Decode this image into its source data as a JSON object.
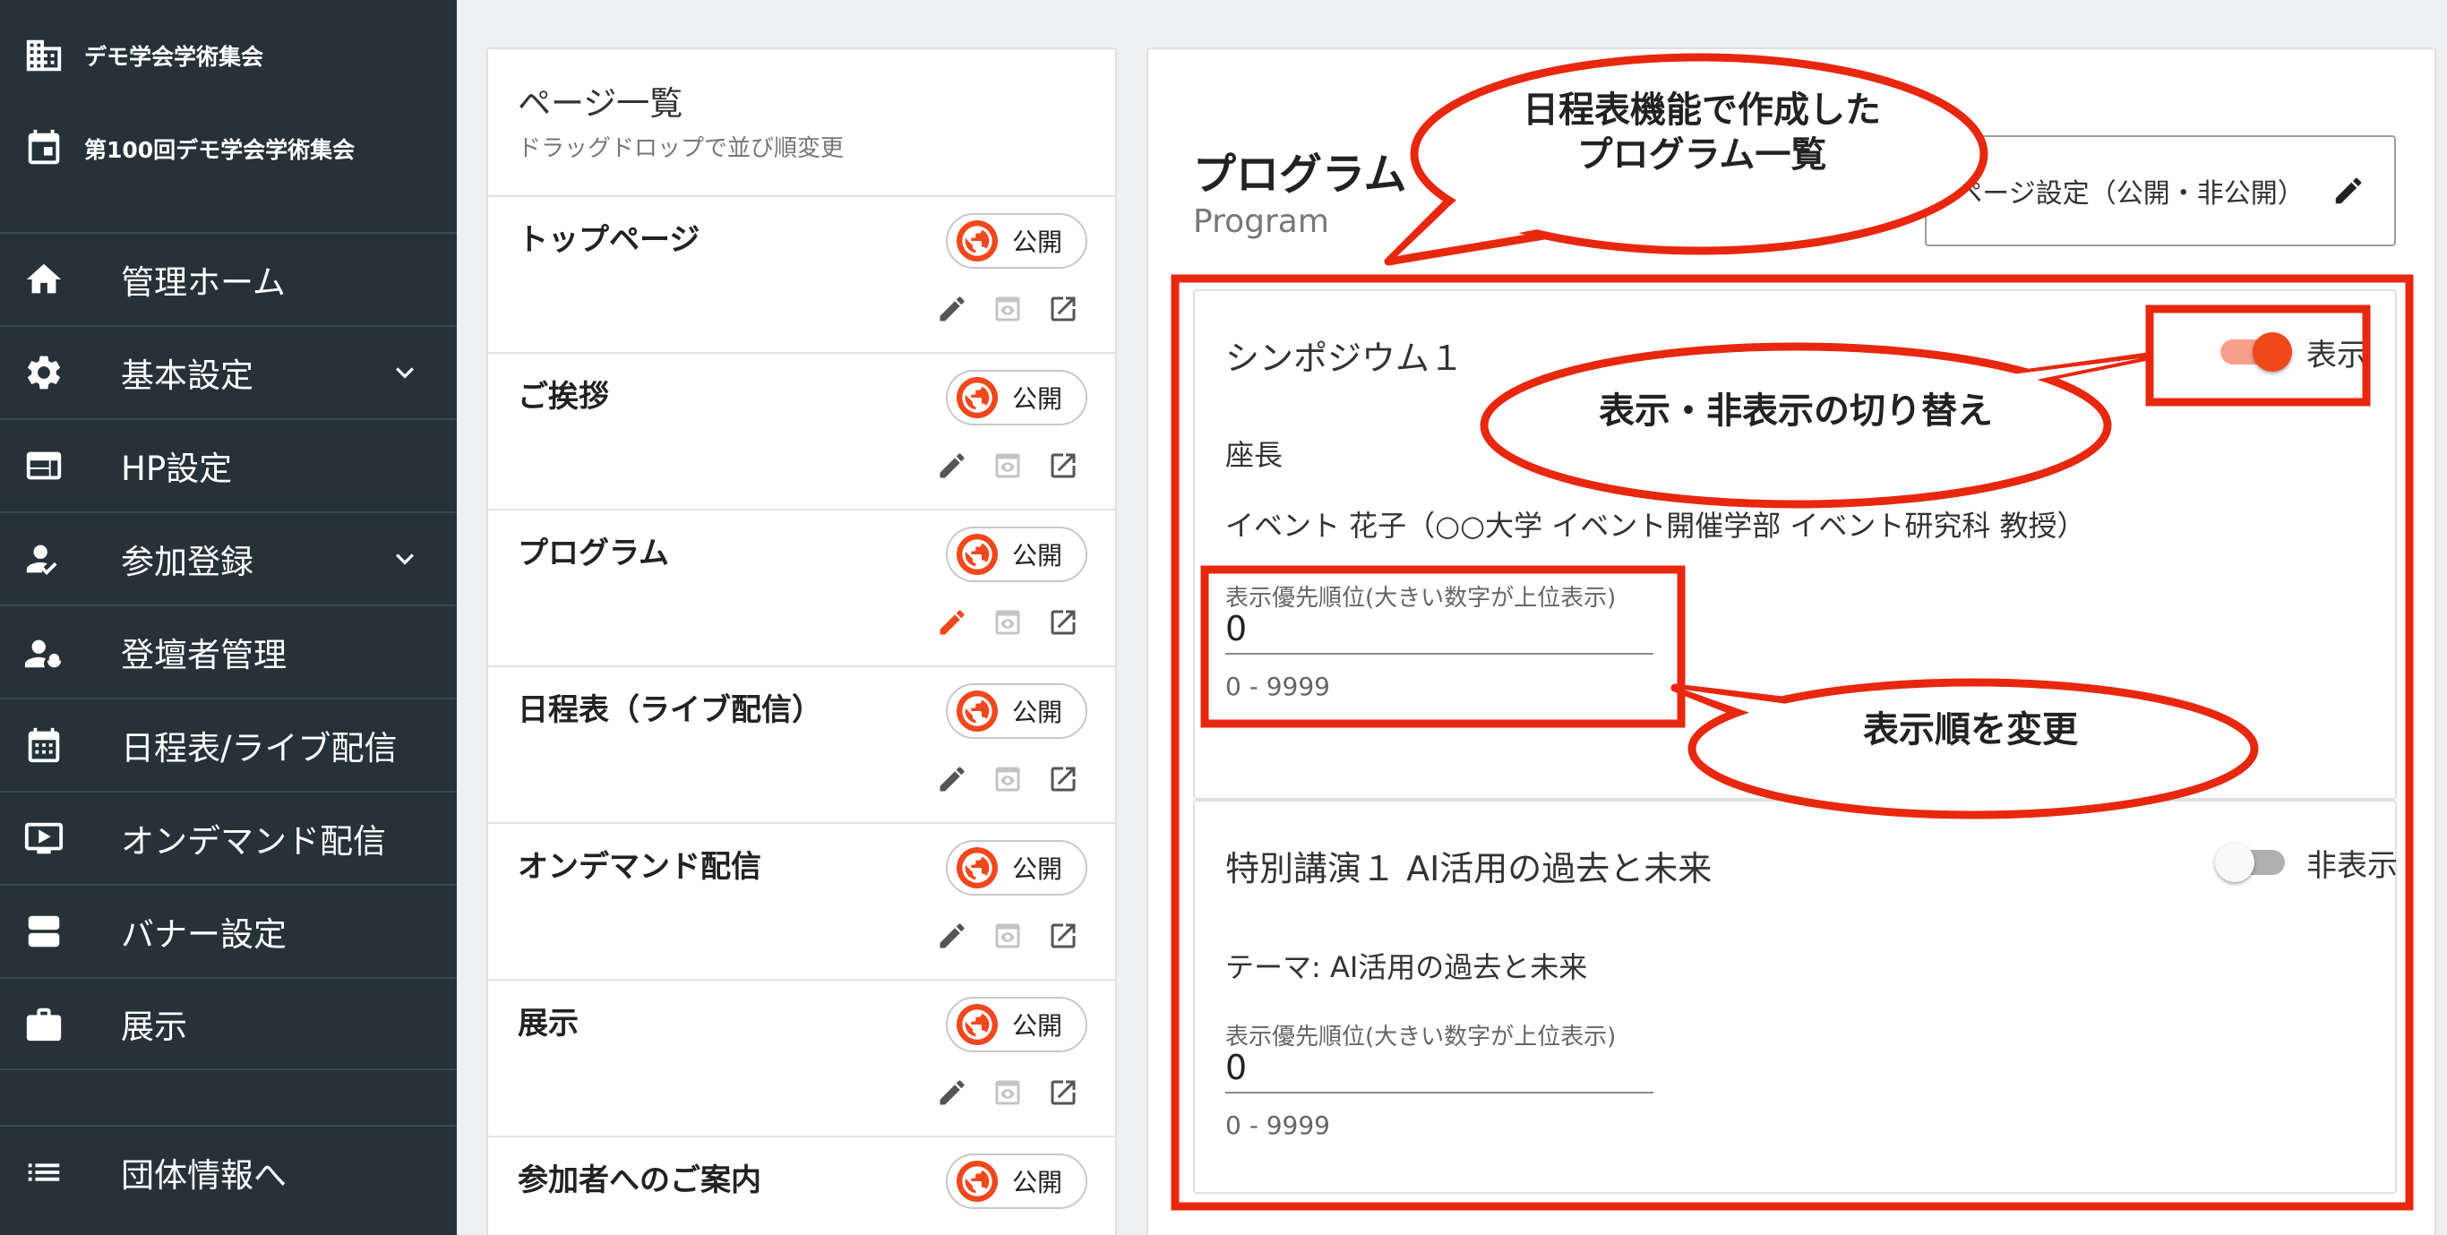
{
  "sidebar": {
    "org_name": "デモ学会学術集会",
    "event_name": "第100回デモ学会学術集会",
    "items": [
      {
        "label": "管理ホーム"
      },
      {
        "label": "基本設定"
      },
      {
        "label": "HP設定"
      },
      {
        "label": "参加登録"
      },
      {
        "label": "登壇者管理"
      },
      {
        "label": "日程表/ライブ配信"
      },
      {
        "label": "オンデマンド配信"
      },
      {
        "label": "バナー設定"
      },
      {
        "label": "展示"
      }
    ],
    "footer_link": "団体情報へ"
  },
  "page_list": {
    "title": "ページ一覧",
    "subtitle": "ドラッグドロップで並び順変更",
    "pages": [
      {
        "name": "トップページ",
        "status": "公開"
      },
      {
        "name": "ご挨拶",
        "status": "公開"
      },
      {
        "name": "プログラム",
        "status": "公開"
      },
      {
        "name": "日程表（ライブ配信）",
        "status": "公開"
      },
      {
        "name": "オンデマンド配信",
        "status": "公開"
      },
      {
        "name": "展示",
        "status": "公開"
      },
      {
        "name": "参加者へのご案内",
        "status": "公開"
      }
    ]
  },
  "program": {
    "title": "プログラム",
    "subtitle": "Program",
    "settings_button": "ページ設定（公開・非公開）",
    "cards": [
      {
        "title": "シンポジウム１",
        "toggle_label": "表示",
        "toggle_on": true,
        "line1": "座長",
        "line2": "イベント 花子（○○大学 イベント開催学部 イベント研究科 教授）",
        "priority_label": "表示優先順位(大きい数字が上位表示)",
        "priority_value": "0",
        "priority_hint": "0 - 9999"
      },
      {
        "title": "特別講演１ AI活用の過去と未来",
        "toggle_label": "非表示",
        "toggle_on": false,
        "line1": "テーマ: AI活用の過去と未来",
        "priority_label": "表示優先順位(大きい数字が上位表示)",
        "priority_value": "0",
        "priority_hint": "0 - 9999"
      }
    ]
  },
  "annotations": {
    "callout1": "日程表機能で作成した\nプログラム一覧",
    "callout2": "表示・非表示の切り替え",
    "callout3": "表示順を変更"
  },
  "colors": {
    "sidebar_bg": "#263238",
    "accent": "#f0471d",
    "annotation": "#e8270f"
  }
}
